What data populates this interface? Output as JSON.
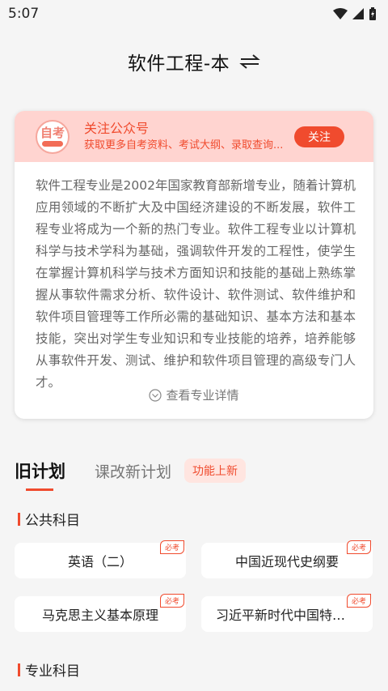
{
  "status": {
    "time": "5:07"
  },
  "header": {
    "title": "软件工程-本"
  },
  "follow": {
    "logo": "自考",
    "title": "关注公众号",
    "subtitle": "获取更多自考资料、考试大纲、录取查询...",
    "button": "关注"
  },
  "description": "软件工程专业是2002年国家教育部新增专业，随着计算机应用领域的不断扩大及中国经济建设的不断发展，软件工程专业将成为一个新的热门专业。软件工程专业以计算机科学与技术学科为基础，强调软件开发的工程性，使学生在掌握计算机科学与技术方面知识和技能的基础上熟练掌握从事软件需求分析、软件设计、软件测试、软件维护和软件项目管理等工作所必需的基础知识、基本方法和基本技能，突出对学生专业知识和专业技能的培养，培养能够从事软件开发、测试、维护和软件项目管理的高级专门人才。",
  "view_detail": "查看专业详情",
  "plans": {
    "old": "旧计划",
    "new": "课改新计划",
    "new_tag": "功能上新"
  },
  "sections": {
    "public": "公共科目",
    "major": "专业科目"
  },
  "subjects": [
    {
      "name": "英语（二）",
      "tag": "必考"
    },
    {
      "name": "中国近现代史纲要",
      "tag": "必考"
    },
    {
      "name": "马克思主义基本原理",
      "tag": "必考"
    },
    {
      "name": "习近平新时代中国特色社会主义思想概论",
      "tag": "必考"
    }
  ],
  "colors": {
    "accent": "#f04b2e",
    "banner": "#ffd4d0",
    "background": "#f5f5f5"
  }
}
